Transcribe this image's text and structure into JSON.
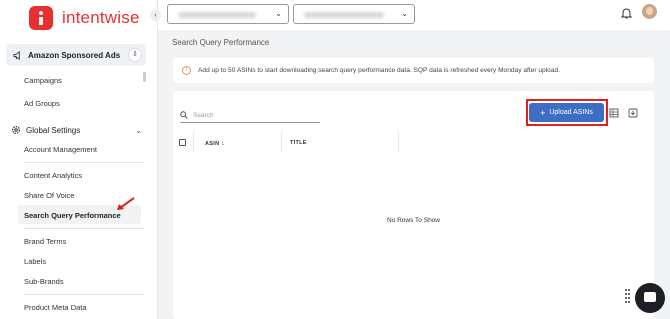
{
  "brand": {
    "name": "intentwise",
    "color": "#e8312f"
  },
  "sidebar": {
    "account": {
      "label": "Amazon Sponsored Ads",
      "icon": "megaphone-icon"
    },
    "ads_items": [
      "Campaigns",
      "Ad Groups"
    ],
    "settings": {
      "label": "Global Settings",
      "icon": "gear-icon"
    },
    "items": [
      "Account Management",
      "Content Analytics",
      "Share Of Voice",
      "Search Query Performance",
      "Brand Terms",
      "Labels",
      "Sub-Brands",
      "Product Meta Data"
    ],
    "active_item": "Search Query Performance"
  },
  "page": {
    "title": "Search Query Performance",
    "info": "Add up to 50 ASINs to start downloading search query performance data. SQP data is refreshed every Monday after upload.",
    "search_placeholder": "Search",
    "upload_label": "Upload ASINs",
    "columns": [
      "ASIN",
      "TITLE"
    ],
    "empty_message": "No Rows To Show",
    "accent": "#3d6ec4",
    "highlight": "#e02020"
  }
}
